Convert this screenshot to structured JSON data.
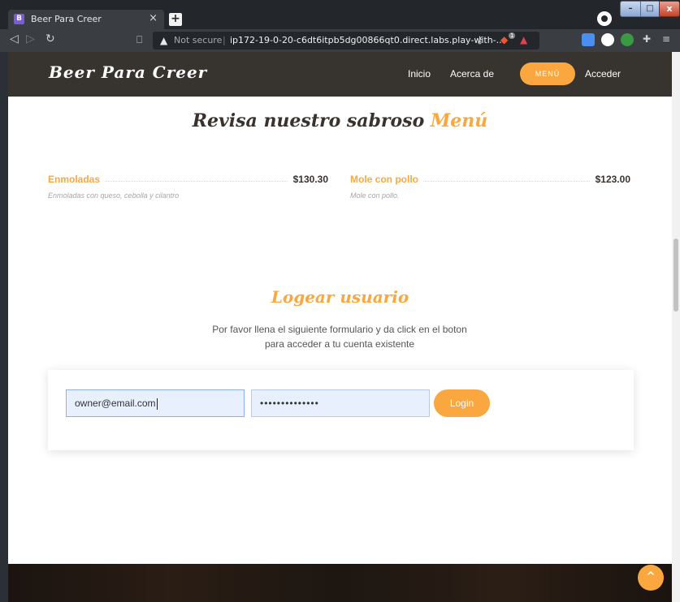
{
  "browser": {
    "tab_title": "Beer Para Creer",
    "tab_favicon": "B",
    "not_secure": "Not secure",
    "url": "ip172-19-0-20-c6dt6itpb5dg00866qt0.direct.labs.play-with-...",
    "brave_badge": "1"
  },
  "site": {
    "logo": "Beer Para Creer",
    "nav": {
      "inicio": "Inicio",
      "acerca": "Acerca de",
      "menu": "MENÚ",
      "acceder": "Acceder"
    },
    "menu_section": {
      "title_main": "Revisa nuestro sabroso",
      "title_accent": "Menú"
    },
    "menu_items": [
      {
        "name": "Enmoladas",
        "price": "$130.30",
        "desc": "Enmoladas con queso, cebolla y cilantro"
      },
      {
        "name": "Mole con pollo",
        "price": "$123.00",
        "desc": "Mole con pollo."
      }
    ],
    "login": {
      "title": "Logear usuario",
      "desc": "Por favor llena el siguiente formulario y da click en el boton para acceder a tu cuenta existente",
      "email_value": "owner@email.com",
      "password_value": "••••••••••••••",
      "button": "Login"
    }
  },
  "colors": {
    "accent": "#f9a73e",
    "header": "#37332f"
  }
}
